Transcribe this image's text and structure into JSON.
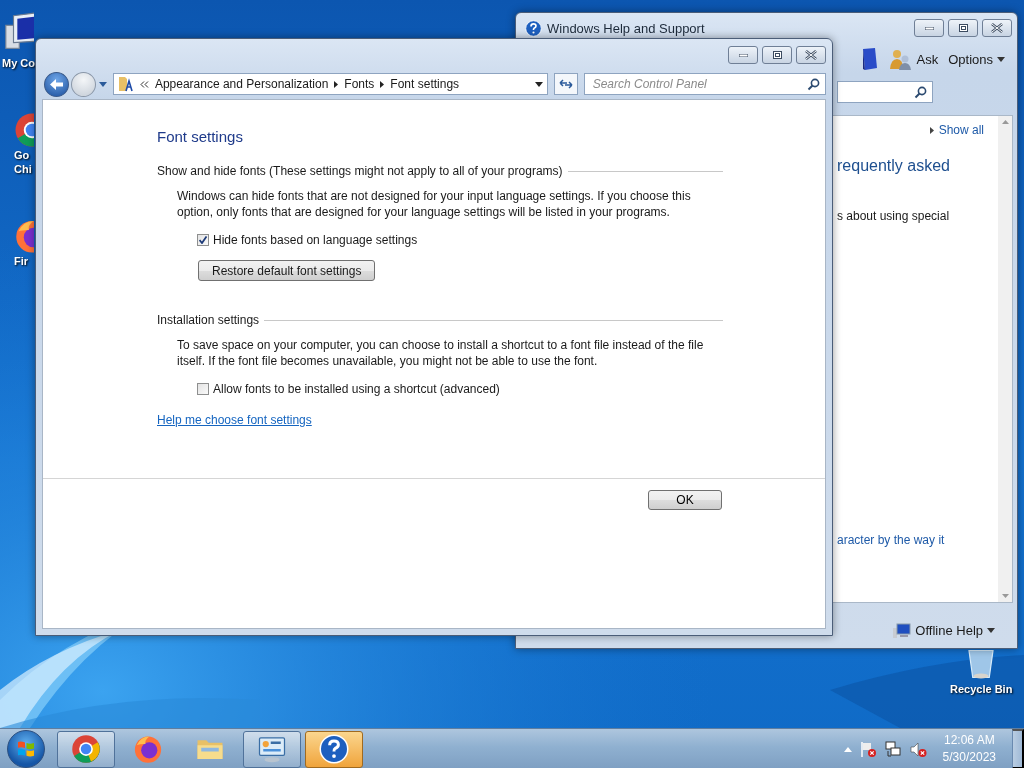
{
  "desktop": {
    "icons": [
      {
        "kind": "computer",
        "lines": [
          "My Co"
        ]
      },
      {
        "kind": "chrome",
        "lines": [
          "Go",
          "Chi"
        ]
      },
      {
        "kind": "firefox",
        "lines": [
          "Fir"
        ]
      },
      {
        "kind": "recycle",
        "lines": [
          "Recycle Bin"
        ]
      }
    ]
  },
  "help_window": {
    "title": "Windows Help and Support",
    "ask_button": "Ask",
    "options_menu": "Options",
    "show_all_link": "Show all",
    "heading": "requently asked",
    "text": "s about using special",
    "link": "aracter by the way it",
    "offline_help": "Offline Help"
  },
  "font_window": {
    "breadcrumb": [
      "Appearance and Personalization",
      "Fonts",
      "Font settings"
    ],
    "search": {
      "placeholder": "Search Control Panel"
    },
    "title": "Font settings",
    "sections": [
      {
        "heading": "Show and hide fonts (These settings might not apply to all of your programs)",
        "text": "Windows can hide fonts that are not designed for your input language settings. If you choose this option, only fonts that are designed for your language settings will be listed in your programs.",
        "checkbox": {
          "label": "Hide fonts based on language settings",
          "checked": true
        },
        "button": "Restore default font settings"
      },
      {
        "heading": "Installation settings",
        "text": "To save space on your computer, you can choose to install a shortcut to a font file instead of the file itself. If the font file becomes unavailable, you might not be able to use the font.",
        "checkbox": {
          "label": "Allow fonts to be installed using a shortcut (advanced)",
          "checked": false
        }
      }
    ],
    "help_link": "Help me choose font settings",
    "ok_button": "OK"
  },
  "taskbar": {
    "items": [
      {
        "kind": "chrome",
        "running": true,
        "active": false
      },
      {
        "kind": "firefox",
        "running": false,
        "active": false
      },
      {
        "kind": "explorer",
        "running": false,
        "active": false
      },
      {
        "kind": "control-panel",
        "running": true,
        "active": false
      },
      {
        "kind": "help",
        "running": true,
        "active": true
      }
    ],
    "clock": {
      "time": "12:06 AM",
      "date": "5/30/2023"
    }
  }
}
